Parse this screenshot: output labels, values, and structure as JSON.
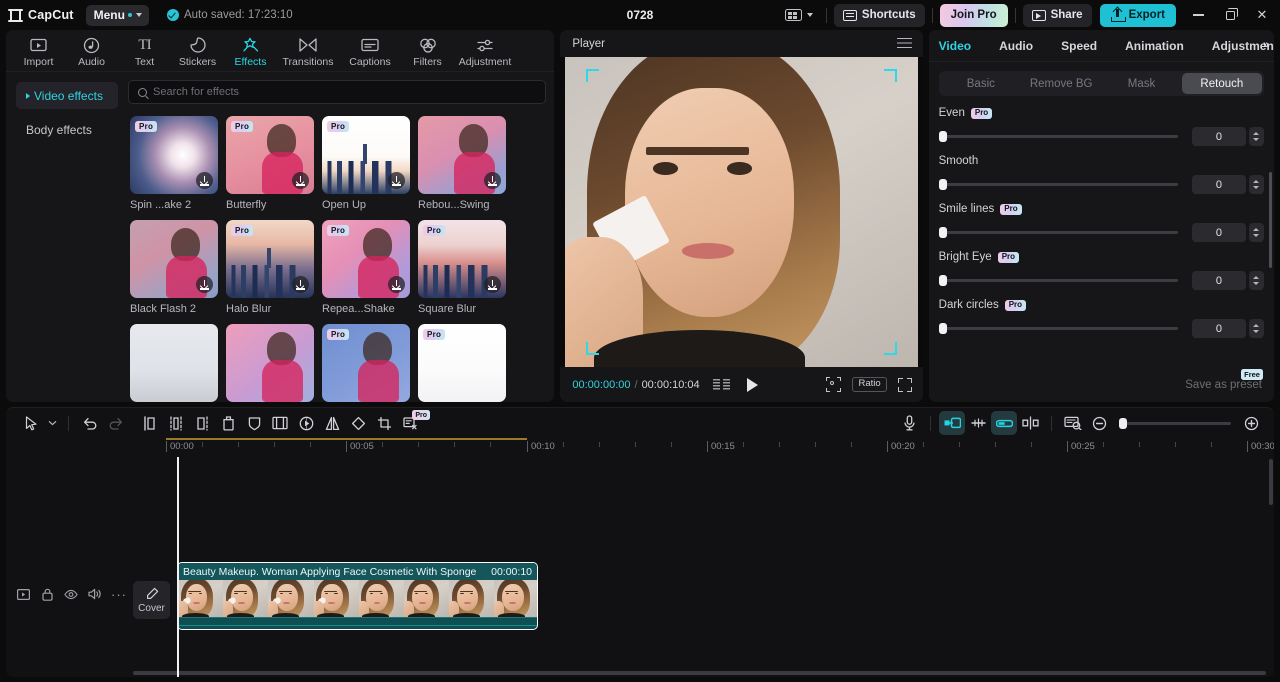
{
  "titlebar": {
    "brand": "CapCut",
    "menu_label": "Menu",
    "autosave": "Auto saved: 17:23:10",
    "project_title": "0728",
    "layout_icon": "keyboard-layout-icon",
    "shortcuts_label": "Shortcuts",
    "join_pro_label": "Join Pro",
    "share_label": "Share",
    "export_label": "Export",
    "minimize": "minimize-icon",
    "maximize": "maximize-icon",
    "close": "close-icon"
  },
  "left_panel": {
    "tabs": [
      {
        "label": "Import",
        "icon": "import-icon",
        "active": false
      },
      {
        "label": "Audio",
        "icon": "audio-note-icon",
        "active": false
      },
      {
        "label": "Text",
        "icon": "text-ti-icon",
        "active": false
      },
      {
        "label": "Stickers",
        "icon": "sticker-icon",
        "active": false
      },
      {
        "label": "Effects",
        "icon": "effects-sparkle-icon",
        "active": true
      },
      {
        "label": "Transitions",
        "icon": "transitions-icon",
        "active": false
      },
      {
        "label": "Captions",
        "icon": "captions-icon",
        "active": false
      },
      {
        "label": "Filters",
        "icon": "filters-icon",
        "active": false
      },
      {
        "label": "Adjustment",
        "icon": "adjustment-sliders-icon",
        "active": false
      }
    ],
    "categories": [
      {
        "label": "Video effects",
        "active": true
      },
      {
        "label": "Body effects",
        "active": false
      }
    ],
    "search": {
      "placeholder": "Search for effects",
      "value": "",
      "icon": "search-icon"
    },
    "effects": [
      {
        "label": "Spin ...ake 2",
        "pro": true,
        "download": true,
        "style": "g-spin",
        "art": "swirl"
      },
      {
        "label": "Butterfly",
        "pro": true,
        "download": true,
        "style": "g-butterfly",
        "art": "person"
      },
      {
        "label": "Open Up",
        "pro": true,
        "download": true,
        "style": "g-openup",
        "art": "city"
      },
      {
        "label": "Rebou...Swing",
        "pro": false,
        "download": true,
        "style": "g-rebound",
        "art": "person"
      },
      {
        "label": "Black Flash 2",
        "pro": false,
        "download": true,
        "style": "g-blackflash",
        "art": "person"
      },
      {
        "label": "Halo Blur",
        "pro": true,
        "download": true,
        "style": "g-halo",
        "art": "city"
      },
      {
        "label": "Repea...Shake",
        "pro": true,
        "download": true,
        "style": "g-repeat",
        "art": "person"
      },
      {
        "label": "Square Blur",
        "pro": true,
        "download": true,
        "style": "g-square",
        "art": "city"
      }
    ],
    "effects_row3": [
      {
        "label": "",
        "pro": false,
        "style": "g-r3a",
        "art": "city"
      },
      {
        "label": "",
        "pro": false,
        "style": "g-r3b",
        "art": "person"
      },
      {
        "label": "",
        "pro": true,
        "style": "g-r3c",
        "art": "person"
      },
      {
        "label": "",
        "pro": true,
        "style": "g-r3d",
        "art": "city"
      }
    ],
    "pro_badge_label": "Pro"
  },
  "player": {
    "title": "Player",
    "menu_icon": "hamburger-icon",
    "current_time": "00:00:00:00",
    "time_separator": "/",
    "total_time": "00:00:10:04",
    "frames_icon": "frames-icon",
    "play_icon": "play-icon",
    "focus_icon": "focus-icon",
    "ratio_label": "Ratio",
    "fullscreen_icon": "fullscreen-icon"
  },
  "right_panel": {
    "tabs": [
      {
        "label": "Video",
        "active": true
      },
      {
        "label": "Audio",
        "active": false
      },
      {
        "label": "Speed",
        "active": false
      },
      {
        "label": "Animation",
        "active": false
      },
      {
        "label": "Adjustment",
        "active": false
      }
    ],
    "overflow_icon": "chevron-double-right-icon",
    "segments": [
      {
        "label": "Basic",
        "active": false
      },
      {
        "label": "Remove BG",
        "active": false
      },
      {
        "label": "Mask",
        "active": false
      },
      {
        "label": "Retouch",
        "active": true
      }
    ],
    "sliders": [
      {
        "label": "Even",
        "pro": true,
        "value": "0"
      },
      {
        "label": "Smooth",
        "pro": false,
        "value": "0"
      },
      {
        "label": "Smile lines",
        "pro": true,
        "value": "0"
      },
      {
        "label": "Bright Eye",
        "pro": true,
        "value": "0"
      },
      {
        "label": "Dark circles",
        "pro": true,
        "value": "0"
      }
    ],
    "pro_badge_label": "Pro",
    "save_preset_label": "Save as preset",
    "free_badge_label": "Free"
  },
  "timeline": {
    "tools_left": [
      {
        "name": "select-cursor-tool",
        "state": "normal"
      },
      {
        "name": "cursor-dropdown-caret",
        "state": "normal"
      },
      {
        "name": "undo-button",
        "state": "normal"
      },
      {
        "name": "redo-button",
        "state": "disabled"
      },
      {
        "name": "split-left-tool",
        "state": "normal"
      },
      {
        "name": "split-right-tool",
        "state": "normal"
      },
      {
        "name": "split-tool",
        "state": "normal"
      },
      {
        "name": "delete-button",
        "state": "normal"
      },
      {
        "name": "mask-shield-tool",
        "state": "normal"
      },
      {
        "name": "freeze-frame-tool",
        "state": "normal"
      },
      {
        "name": "reverse-tool",
        "state": "normal"
      },
      {
        "name": "mirror-tool",
        "state": "normal"
      },
      {
        "name": "rotate-tool",
        "state": "normal"
      },
      {
        "name": "crop-tool",
        "state": "normal"
      },
      {
        "name": "extract-audio-tool",
        "state": "pro"
      }
    ],
    "tools_right": [
      {
        "name": "record-voiceover-button",
        "state": "normal"
      },
      {
        "name": "auto-snap-toggle",
        "state": "active"
      },
      {
        "name": "adjust-track-height-button",
        "state": "normal"
      },
      {
        "name": "link-clips-toggle",
        "state": "active"
      },
      {
        "name": "split-at-playhead-button",
        "state": "normal"
      },
      {
        "name": "timeline-preview-button",
        "state": "normal"
      },
      {
        "name": "zoom-out-button",
        "state": "normal"
      },
      {
        "name": "zoom-in-button",
        "state": "normal"
      }
    ],
    "tool_pro_label": "Pro",
    "ruler_labels": [
      "00:00",
      "00:05",
      "00:10",
      "00:15",
      "00:20",
      "00:25",
      "00:30"
    ],
    "track_controls": [
      {
        "name": "track-type-icon"
      },
      {
        "name": "lock-icon"
      },
      {
        "name": "eye-visibility-icon"
      },
      {
        "name": "speaker-mute-icon"
      },
      {
        "name": "more-options-icon"
      }
    ],
    "cover_label": "Cover",
    "cover_icon": "pencil-icon",
    "clip": {
      "title": "Beauty Makeup. Woman Applying Face Cosmetic With Sponge",
      "duration": "00:00:10",
      "thumb_count": 8
    },
    "playhead_time": "00:00"
  },
  "colors": {
    "accent_cyan": "#2fd4e0",
    "export_bg": "#1fc0d4",
    "clip_teal": "#15565b",
    "panel_bg": "#161619",
    "window_bg": "#0b0b0c"
  }
}
